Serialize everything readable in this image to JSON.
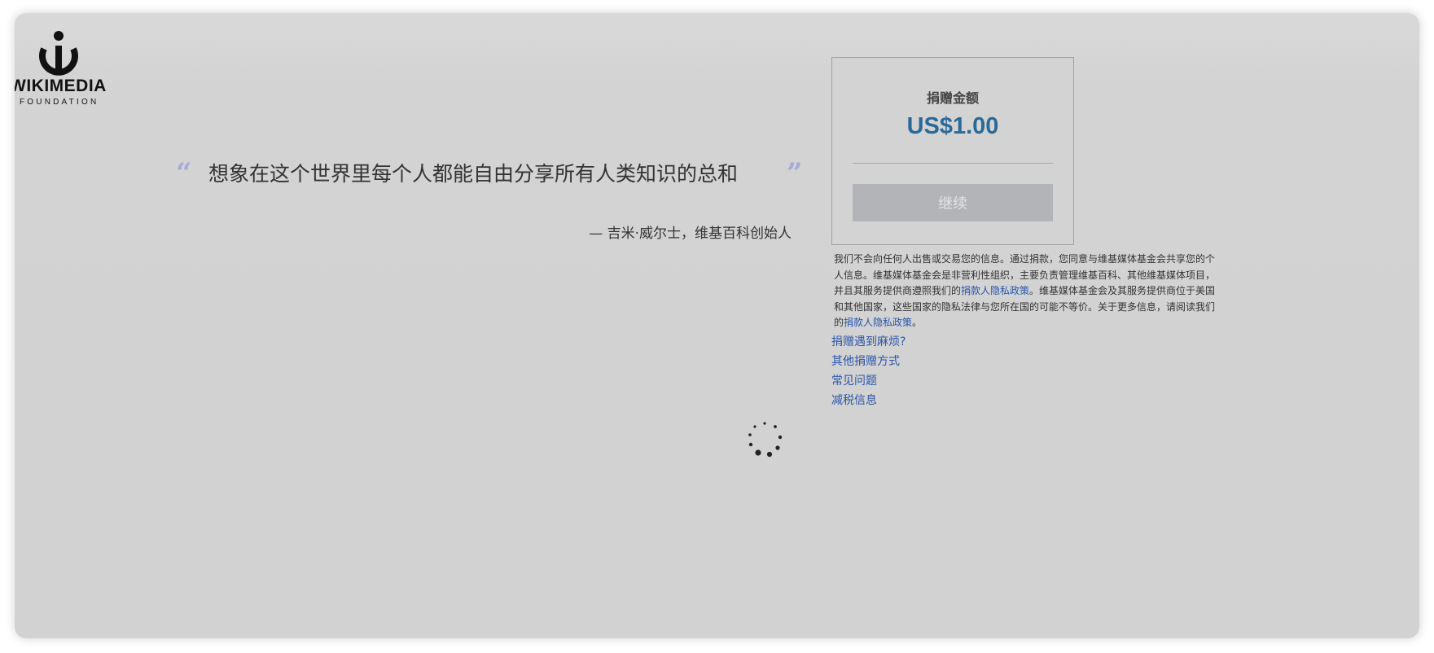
{
  "logo": {
    "wordmark": "WIKIMEDIA",
    "subtitle": "FOUNDATION"
  },
  "quote": {
    "open_mark": "“",
    "text": "想象在这个世界里每个人都能自由分享所有人类知识的总和",
    "close_mark": "”",
    "author": "— 吉米·威尔士，维基百科创始人"
  },
  "donation": {
    "amount_label": "捐赠金额",
    "amount_value": "US$1.00",
    "continue_label": "继续"
  },
  "privacy": {
    "part1": "我们不会向任何人出售或交易您的信息。通过捐款，您同意与维基媒体基金会共享您的个人信息。维基媒体基金会是非营利性组织，主要负责管理维基百科、其他维基媒体项目，并且其服务提供商遵照我们的",
    "link1": "捐款人隐私政策",
    "part2": "。维基媒体基金会及其服务提供商位于美国和其他国家，这些国家的隐私法律与您所在国的可能不等价。关于更多信息，请阅读我们的",
    "link2": "捐款人隐私政策",
    "part3": "。"
  },
  "links": [
    {
      "label": "捐赠遇到麻烦?"
    },
    {
      "label": "其他捐赠方式"
    },
    {
      "label": "常见问题"
    },
    {
      "label": "减税信息"
    }
  ],
  "colors": {
    "accent": "#2a6a99",
    "link": "#2a55a8",
    "quote_mark": "#a5aad6",
    "button_disabled": "#b3b4b8"
  }
}
